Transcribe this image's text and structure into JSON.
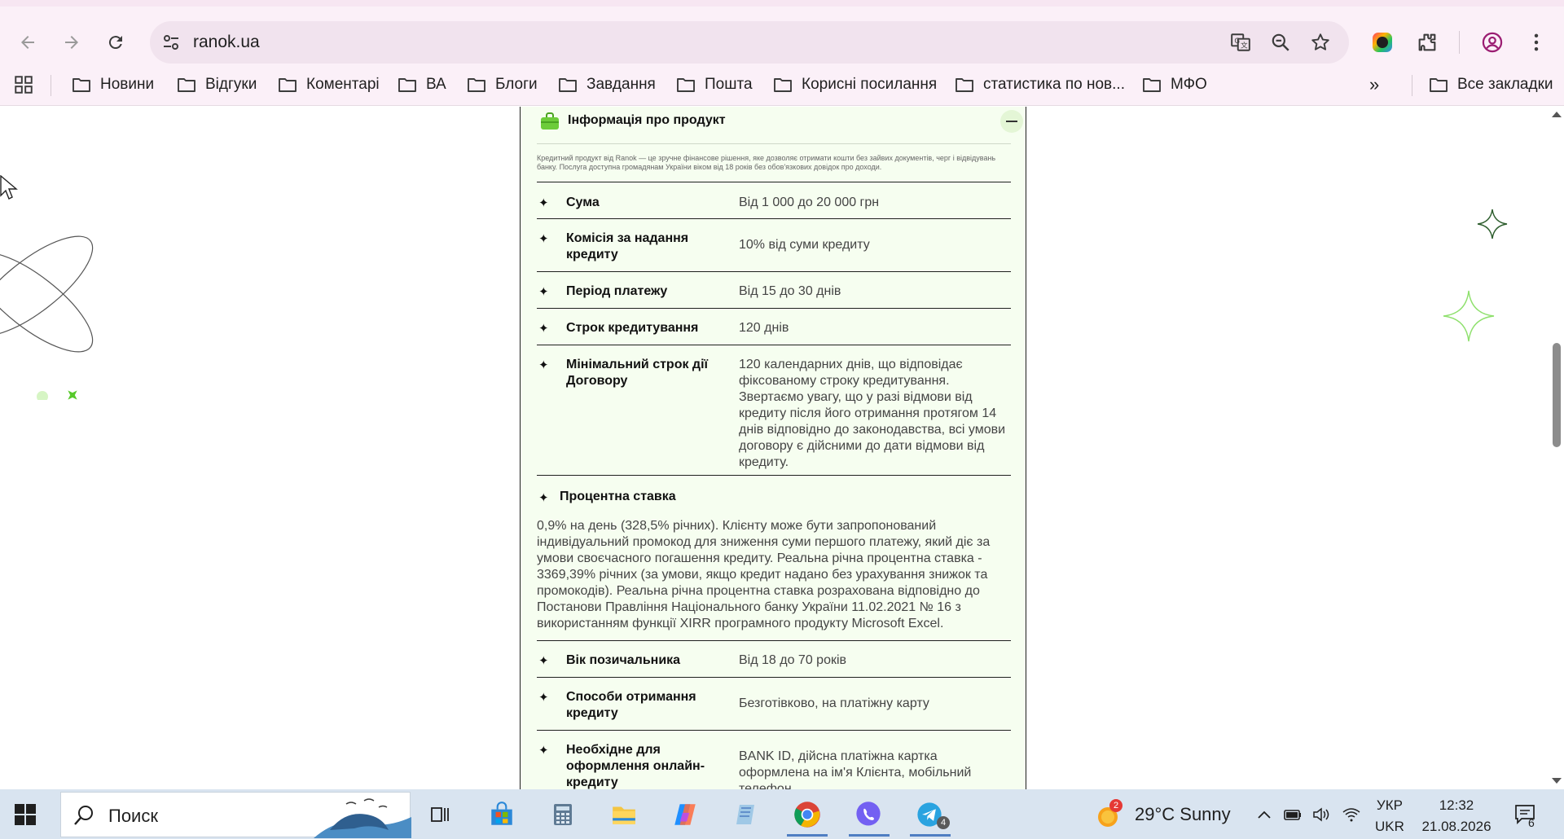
{
  "browser": {
    "url": "ranok.ua",
    "bookmarks": [
      "Новини",
      "Відгуки",
      "Коментарі",
      "ВА",
      "Блоги",
      "Завдання",
      "Пошта",
      "Корисні посилання",
      "статистика по нов...",
      "МФО"
    ],
    "all_bookmarks": "Все закладки",
    "overflow": "»"
  },
  "card": {
    "title": "Інформація про продукт",
    "intro": "Кредитний продукт від Ranok — це зручне фінансове рішення, яке дозволяє отримати кошти без зайвих документів, черг і відвідувань банку. Послуга доступна громадянам України віком від 18 років без обов'язкових довідок про доходи.",
    "rows": [
      {
        "key": "Сума",
        "value": "Від 1 000 до 20 000 грн"
      },
      {
        "key": "Комісія за надання кредиту",
        "value": "10% від суми кредиту"
      },
      {
        "key": "Період платежу",
        "value": "Від 15 до 30 днів"
      },
      {
        "key": "Строк кредитування",
        "value": "120 днів"
      },
      {
        "key": "Мінімальний строк дії Договору",
        "value": "120 календарних днів, що відповідає фіксованому строку кредитування. Звертаємо увагу, що у разі відмови від кредиту після його отримання протягом 14 днів відповідно до законодавства, всі умови договору є дійсними до дати відмови від кредиту."
      }
    ],
    "rate": {
      "title": "Процентна ставка",
      "text": "0,9% на день (328,5% річних). Клієнту може бути запропонований індивідуальний промокод для зниження суми першого платежу, який діє за умови своєчасного погашення кредиту. Реальна річна процентна ставка - 3369,39% річних (за умови, якщо кредит надано без урахування знижок та промокодів). Реальна річна процентна ставка розрахована відповідно до Постанови Правління Національного банку України 11.02.2021 № 16 з використанням функції XIRR програмного продукту Microsoft Excel."
    },
    "rows2": [
      {
        "key": "Вік позичальника",
        "value": "Від 18 до 70 років"
      },
      {
        "key": "Способи отримання кредиту",
        "value": "Безготівково, на платіжну карту"
      },
      {
        "key": "Необхідне для оформлення онлайн-кредиту",
        "value": "BANK ID, дійсна платіжна картка оформлена на ім'я Клієнта, мобільний телефон"
      }
    ],
    "bullet": "✦"
  },
  "taskbar": {
    "search": "Поиск",
    "weather": "29°C  Sunny",
    "weather_badge": "2",
    "telegram_badge": "4",
    "lang_top": "УКР",
    "lang_bottom": "UKR",
    "time": "12:32",
    "date": "21.08.2026",
    "notifications": "6"
  },
  "colors": {
    "chrome_bg": "#fbf0f8",
    "card_bg": "#f6fef0",
    "accent_green": "#6dcc3a",
    "taskbar_bg": "#d9e4f0"
  }
}
